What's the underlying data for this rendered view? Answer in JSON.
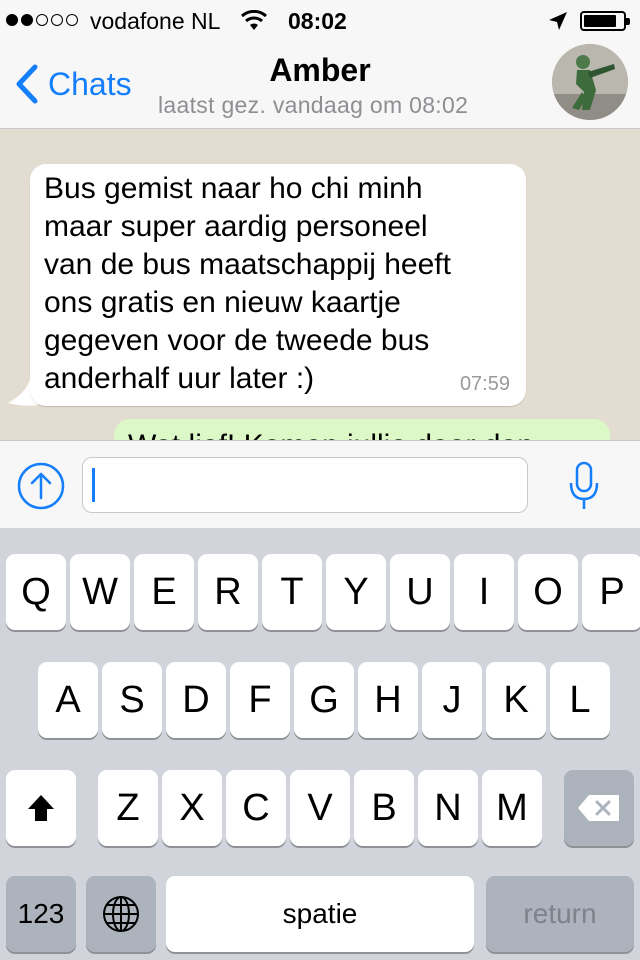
{
  "status_bar": {
    "signal_dots_filled": 2,
    "signal_dots_total": 5,
    "carrier": "vodafone NL",
    "time": "08:02",
    "battery_level": 0.85,
    "icons": [
      "signal-dots-icon",
      "wifi-icon",
      "location-arrow-icon",
      "battery-icon"
    ]
  },
  "nav": {
    "back_label": "Chats",
    "contact_name": "Amber",
    "last_seen": "laatst gez. vandaag om 08:02",
    "avatar_icon": "toy-soldier-avatar"
  },
  "messages": [
    {
      "direction": "incoming",
      "lines": [
        "Bus gemist naar ho chi minh",
        "maar super aardig personeel",
        "van de bus maatschappij heeft",
        "ons gratis en nieuw kaartje",
        "gegeven voor de tweede bus",
        "anderhalf uur later :)"
      ],
      "time": "07:59"
    },
    {
      "direction": "outgoing",
      "text": "Wat lief! Komen jullie daar dan"
    }
  ],
  "composer": {
    "value": "",
    "placeholder": "",
    "attach_icon": "upload-arrow-icon",
    "mic_icon": "microphone-icon"
  },
  "keyboard": {
    "row1": [
      "Q",
      "W",
      "E",
      "R",
      "T",
      "Y",
      "U",
      "I",
      "O",
      "P"
    ],
    "row2": [
      "A",
      "S",
      "D",
      "F",
      "G",
      "H",
      "J",
      "K",
      "L"
    ],
    "row3": [
      "Z",
      "X",
      "C",
      "V",
      "B",
      "N",
      "M"
    ],
    "numbers_label": "123",
    "space_label": "spatie",
    "return_label": "return",
    "shift_icon": "shift-arrow-icon",
    "globe_icon": "globe-icon",
    "delete_icon": "backspace-icon"
  },
  "colors": {
    "accent": "#147efb",
    "outgoing_bubble": "#dcf8c6",
    "incoming_bubble": "#ffffff",
    "chat_background": "#e2dcd1",
    "keyboard_background": "#d1d5db"
  }
}
